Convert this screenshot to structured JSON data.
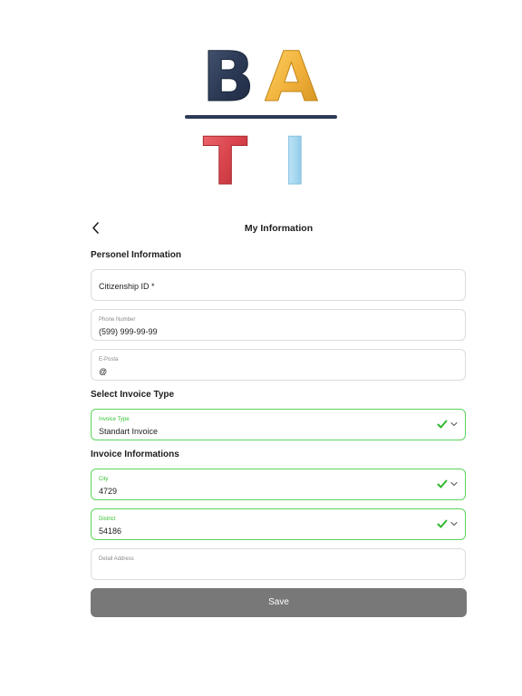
{
  "logo": {
    "letters": [
      "B",
      "A",
      "T",
      "I"
    ],
    "colors": {
      "b": "#2c3a55",
      "a": "#f2b33d",
      "t": "#d9434b",
      "i": "#a9d8f0",
      "bar": "#2c3a55"
    }
  },
  "header": {
    "title": "My Information",
    "back_icon": "chevron-left-icon"
  },
  "sections": {
    "personal": "Personel Information",
    "invoice_type": "Select Invoice Type",
    "invoice_info": "Invoice Informations"
  },
  "fields": {
    "citizenship": {
      "placeholder": "Citizenship ID *"
    },
    "phone": {
      "label": "Phone Number",
      "value": "(599) 999-99-99"
    },
    "email": {
      "label": "E-Posta",
      "value": "@"
    },
    "invoice_type": {
      "label": "Invoice Type",
      "value": "Standart Invoice"
    },
    "city": {
      "label": "City",
      "value": "4729"
    },
    "district": {
      "label": "District",
      "value": "54186"
    },
    "address": {
      "label": "Detail Address",
      "value": ""
    }
  },
  "save_label": "Save",
  "colors": {
    "valid_border": "#5cd45c",
    "valid_label": "#34c234",
    "check": "#2fb82f",
    "button_bg": "#777877"
  }
}
